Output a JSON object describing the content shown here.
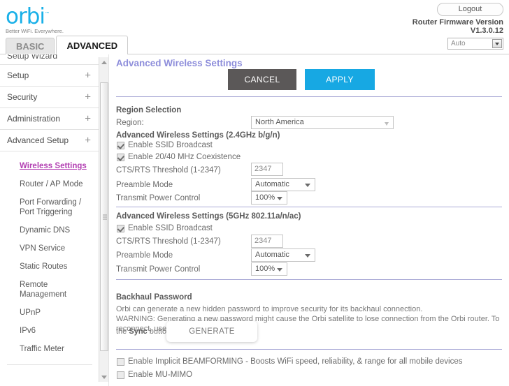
{
  "brand": {
    "logo_text": "orbi",
    "logo_tm": "™",
    "tagline": "Better WiFi. Everywhere."
  },
  "header": {
    "logout_label": "Logout",
    "firmware_label": "Router Firmware Version",
    "firmware_version": "V1.3.0.12",
    "language_value": "Auto"
  },
  "tabs": [
    {
      "label": "BASIC",
      "active": false
    },
    {
      "label": "ADVANCED",
      "active": true
    }
  ],
  "sidebar": {
    "clipped_top_item": "Setup Wizard",
    "groups": [
      {
        "label": "Setup",
        "expander": "+"
      },
      {
        "label": "Security",
        "expander": "+"
      },
      {
        "label": "Administration",
        "expander": "+"
      },
      {
        "label": "Advanced Setup",
        "expander": "+"
      }
    ],
    "sub_items": [
      {
        "label": "Wireless Settings",
        "active": true
      },
      {
        "label": "Router / AP Mode",
        "active": false
      },
      {
        "label": "Port Forwarding / Port Triggering",
        "active": false
      },
      {
        "label": "Dynamic DNS",
        "active": false
      },
      {
        "label": "VPN Service",
        "active": false
      },
      {
        "label": "Static Routes",
        "active": false
      },
      {
        "label": "Remote Management",
        "active": false
      },
      {
        "label": "UPnP",
        "active": false
      },
      {
        "label": "IPv6",
        "active": false
      },
      {
        "label": "Traffic Meter",
        "active": false
      }
    ]
  },
  "main": {
    "page_title": "Advanced Wireless Settings",
    "cancel_label": "CANCEL",
    "apply_label": "APPLY",
    "region_section": {
      "heading": "Region Selection",
      "region_label": "Region:",
      "region_value": "North America"
    },
    "band_24": {
      "heading": "Advanced Wireless Settings (2.4GHz b/g/n)",
      "ssid_broadcast_label": "Enable SSID Broadcast",
      "ssid_broadcast_checked": true,
      "coexistence_label": "Enable 20/40 MHz Coexistence",
      "coexistence_checked": true,
      "cts_rts_label": "CTS/RTS Threshold (1-2347)",
      "cts_rts_value": "2347",
      "preamble_label": "Preamble Mode",
      "preamble_value": "Automatic",
      "power_label": "Transmit Power Control",
      "power_value": "100%"
    },
    "band_5": {
      "heading": "Advanced Wireless Settings (5GHz 802.11a/n/ac)",
      "ssid_broadcast_label": "Enable SSID Broadcast",
      "ssid_broadcast_checked": true,
      "cts_rts_label": "CTS/RTS Threshold (1-2347)",
      "cts_rts_value": "2347",
      "preamble_label": "Preamble Mode",
      "preamble_value": "Automatic",
      "power_label": "Transmit Power Control",
      "power_value": "100%"
    },
    "backhaul": {
      "heading": "Backhaul Password",
      "line1": "Orbi can generate a new hidden password to improve security for its backhaul connection.",
      "line2": "WARNING: Generating a new password might cause the Orbi satellite to lose connection from the Orbi router. To reconnect, use",
      "line3_pre": "the ",
      "line3_bold": "Sync",
      "line3_post": " button.",
      "generate_label": "GENERATE"
    },
    "footer_options": [
      {
        "label": "Enable Implicit BEAMFORMING - Boosts WiFi speed, reliability, & range for all mobile devices",
        "checked": false
      },
      {
        "label": "Enable MU-MIMO",
        "checked": false
      }
    ]
  },
  "colors": {
    "brand_blue": "#19b0e8",
    "apply_blue": "#17a8e3",
    "cancel_gray": "#5b5858",
    "title_purple": "#8e8edb",
    "active_link_purple": "#b23fb2",
    "divider_purple": "#a9a9d6"
  }
}
